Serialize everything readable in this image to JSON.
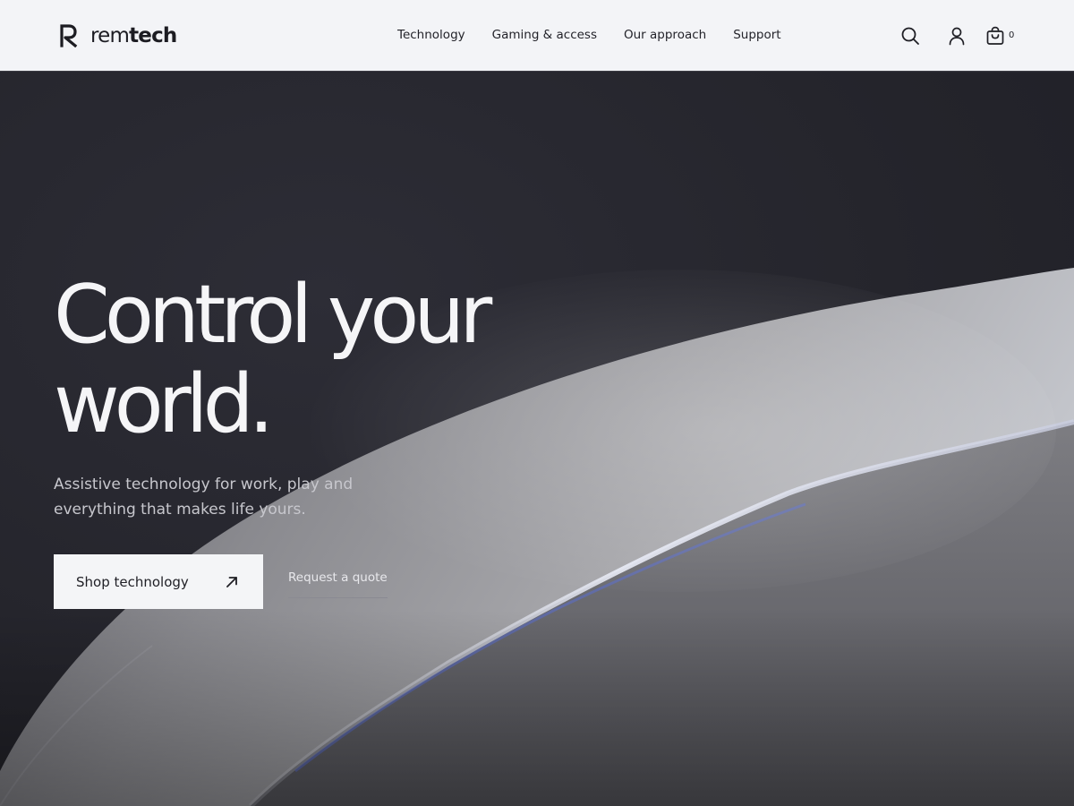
{
  "brand": {
    "name_light": "rem",
    "name_bold": "tech",
    "logo_icon": "r-monogram-icon"
  },
  "nav": {
    "items": [
      {
        "label": "Technology"
      },
      {
        "label": "Gaming & access"
      },
      {
        "label": "Our approach"
      },
      {
        "label": "Support"
      }
    ]
  },
  "tools": {
    "search_icon": "search-icon",
    "account_icon": "user-icon",
    "cart_icon": "shopping-bag-icon",
    "cart_count": "0"
  },
  "hero": {
    "headline_line1": "Control your",
    "headline_line2": "world.",
    "subtext": "Assistive technology for work, play and everything that makes life yours.",
    "primary_cta": "Shop technology",
    "primary_cta_icon": "arrow-up-right-icon",
    "secondary_cta": "Request a quote"
  },
  "colors": {
    "header_bg": "#f3f4f7",
    "hero_bg": "#27272f",
    "text_light": "#f5f5f7",
    "text_dark": "#1c1c22",
    "accent_blue_highlight": "#5a6ecf"
  }
}
